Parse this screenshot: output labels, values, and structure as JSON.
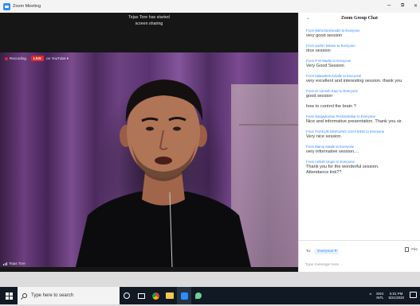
{
  "window": {
    "title": "Zoom Meeting",
    "minimize": "–",
    "restore": "⧉",
    "close": "✕"
  },
  "video": {
    "share_banner_line1": "Tejas Tore has started",
    "share_banner_line2": "screen sharing",
    "recording_label": "Recording",
    "live_label": "LIVE",
    "youtube_label": "on YouTube ▾",
    "participant_name": "Tejas Tore"
  },
  "chat": {
    "title": "Zoom Group Chat",
    "collapse_icon": "chevron-down-icon",
    "messages": [
      {
        "from": "From Nikhil Deshmukh to Everyone",
        "body": "very good session"
      },
      {
        "from": "From sachin kolane to Everyone",
        "body": "nice session"
      },
      {
        "from": "From P M Wadte to Everyone",
        "body": "Very Good Session"
      },
      {
        "from": "From balasaheb Kavitle to Everyone",
        "body": "very excellent and interesting session. thank you"
      },
      {
        "from": "From Dr Umesh Kaur to Everyone",
        "body": "good session"
      },
      {
        "from": "",
        "body": "how to control the brain ?"
      },
      {
        "from": "From Sanjaykumar Pechandekar to Everyone",
        "body": "Nice and informative presentation. Thank you sir."
      },
      {
        "from": "From THAKUR DINKSING VIJAYSING to Everyone",
        "body": "Very nice session."
      },
      {
        "from": "From Manoj Satale to Everyone",
        "body": "very informative session...."
      },
      {
        "from": "From Ashish Ungre to Everyone",
        "body": "Thank you for the wonderful session.",
        "body2": "Attendance link??"
      }
    ],
    "to_label": "To:",
    "to_value": "Everyone ▾",
    "file_label": "File",
    "input_placeholder": "Type message here..."
  },
  "taskbar": {
    "search_placeholder": "Type here to search",
    "lang_line1": "ENG",
    "lang_line2": "INTL",
    "time": "5:01 PM",
    "date": "5/21/2020",
    "tray_chevron": "^"
  },
  "colors": {
    "zoom_blue": "#2d8cff",
    "live_red": "#e02828",
    "taskbar": "#101924"
  }
}
